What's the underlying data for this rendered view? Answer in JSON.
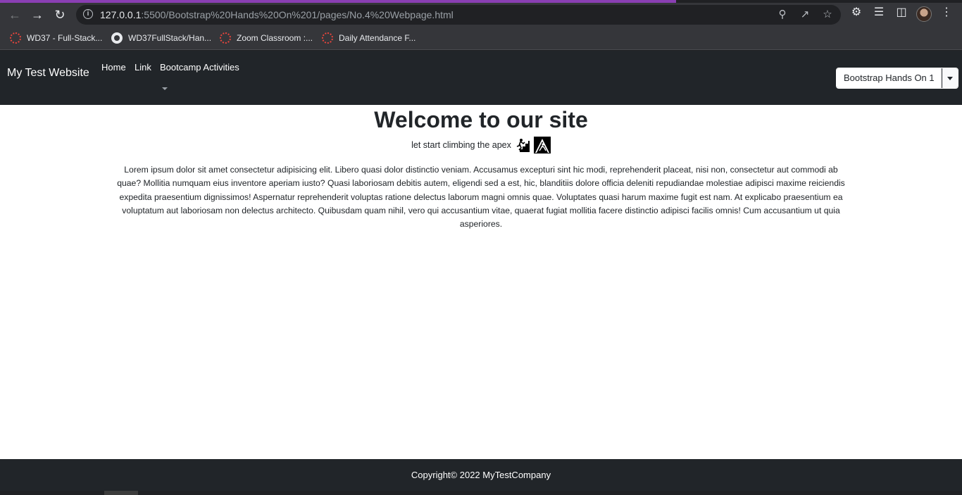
{
  "browser": {
    "url_host": "127.0.0.1",
    "url_rest": ":5500/Bootstrap%20Hands%20On%201/pages/No.4%20Webpage.html",
    "bookmarks": [
      {
        "label": "WD37 - Full-Stack..."
      },
      {
        "label": "WD37FullStack/Han..."
      },
      {
        "label": "Zoom Classroom :..."
      },
      {
        "label": "Daily Attendance F..."
      }
    ]
  },
  "navbar": {
    "brand": "My Test Website",
    "links": [
      "Home",
      "Link",
      "Bootcamp Activities"
    ],
    "split_button_label": "Bootstrap Hands On 1"
  },
  "main": {
    "title": "Welcome to our site",
    "tagline": "let start climbing the apex",
    "paragraph": "Lorem ipsum dolor sit amet consectetur adipisicing elit. Libero quasi dolor distinctio veniam. Accusamus excepturi sint hic modi, reprehenderit placeat, nisi non, consectetur aut commodi ab quae? Mollitia numquam eius inventore aperiam iusto? Quasi laboriosam debitis autem, eligendi sed a est, hic, blanditiis dolore officia deleniti repudiandae molestiae adipisci maxime reiciendis expedita praesentium dignissimos! Aspernatur reprehenderit voluptas ratione delectus laborum magni omnis quae. Voluptates quasi harum maxime fugit est nam. At explicabo praesentium ea voluptatum aut laboriosam non delectus architecto. Quibusdam quam nihil, vero qui accusantium vitae, quaerat fugiat mollitia facere distinctio adipisci facilis omnis! Cum accusantium ut quia asperiores."
  },
  "footer": {
    "text": "Copyright© 2022 MyTestCompany"
  },
  "colors": {
    "navbar_bg": "#212529",
    "tab_accent": "#8a3fb3"
  }
}
